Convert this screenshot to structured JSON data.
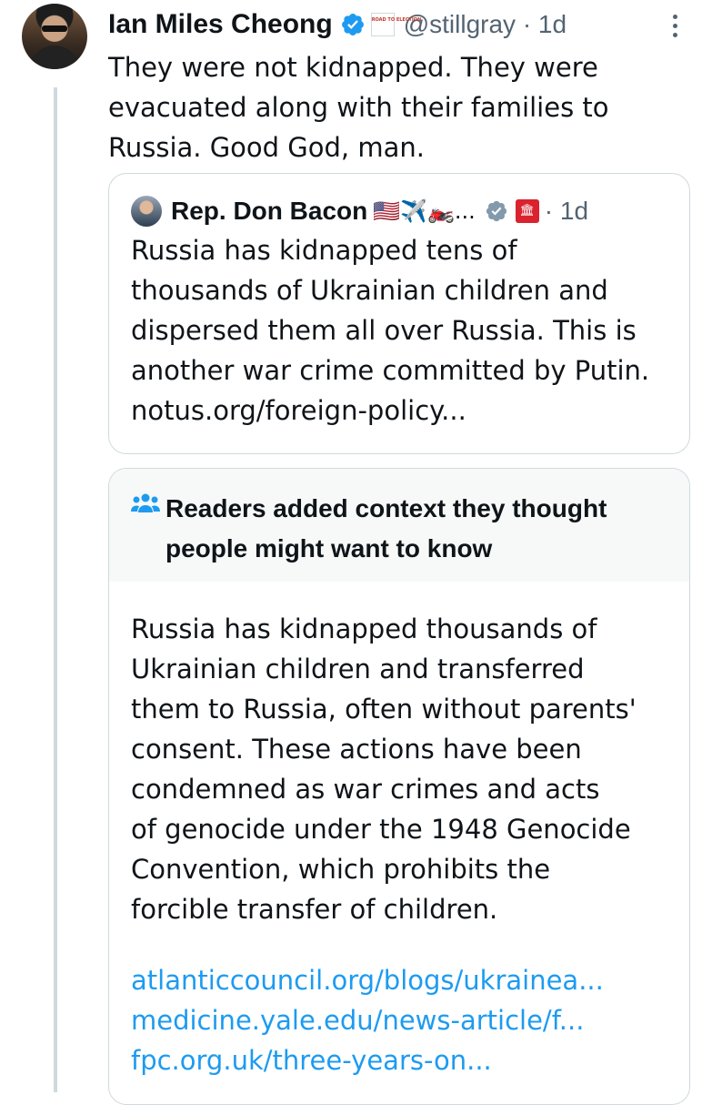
{
  "tweet": {
    "author_name": "Ian Miles Cheong",
    "handle": "@stillgray",
    "time": "· 1d",
    "affiliation_badge": "ROAD TO ELECTION",
    "text_lines": [
      "They were not kidnapped. They were",
      "evacuated along with their families to",
      "Russia. Good God, man."
    ],
    "icons": [
      "verified-badge-icon",
      "affiliation-badge-icon",
      "more-options-icon"
    ]
  },
  "quote": {
    "author_name": "Rep. Don Bacon",
    "emojis": "🇺🇸✈️🏍️...",
    "affiliation_badge": "🏛",
    "time": "· 1d",
    "text_lines": [
      "Russia has kidnapped tens of",
      "thousands of Ukrainian children and",
      "dispersed them all over Russia. This is",
      "another war crime committed by Putin.",
      "notus.org/foreign-policy..."
    ]
  },
  "community_note": {
    "title_lines": [
      "Readers added context they thought",
      "people might want to know"
    ],
    "body_lines": [
      "Russia has kidnapped thousands of",
      "Ukrainian children and transferred",
      "them to Russia, often without parents'",
      "consent. These actions have been",
      "condemned as war crimes and acts",
      "of genocide under the 1948 Genocide",
      "Convention, which prohibits the",
      "forcible transfer of children."
    ],
    "links": [
      "atlanticcouncil.org/blogs/ukrainea...",
      "medicine.yale.edu/news-article/f...",
      "fpc.org.uk/three-years-on..."
    ]
  },
  "colors": {
    "text": "#0f1419",
    "secondary": "#536471",
    "link": "#1d9bf0",
    "border": "#cfd9de",
    "note_header_bg": "#f7f9f9",
    "verified": "#1d9bf0"
  }
}
